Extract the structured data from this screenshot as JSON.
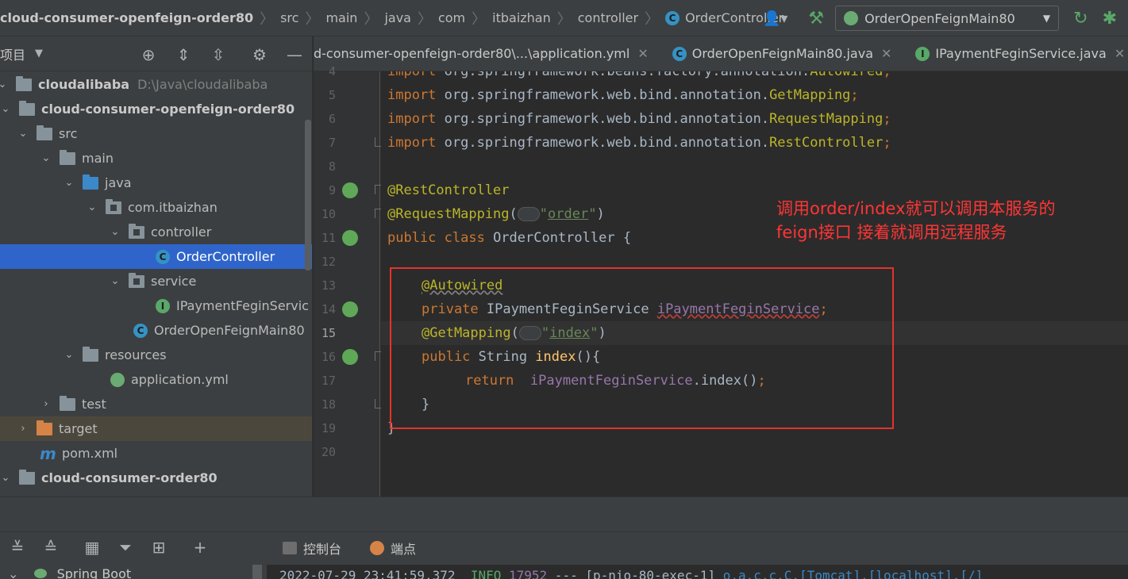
{
  "breadcrumbs": [
    "cloud-consumer-openfeign-order80",
    "src",
    "main",
    "java",
    "com",
    "itbaizhan",
    "controller",
    "OrderController"
  ],
  "run_config": "OrderOpenFeignMain80",
  "project": {
    "title": "项目",
    "tree": [
      {
        "label": "cloudalibaba",
        "path": "D:\\Java\\cloudalibaba"
      },
      {
        "label": "cloud-consumer-openfeign-order80"
      },
      {
        "label": "src"
      },
      {
        "label": "main"
      },
      {
        "label": "java"
      },
      {
        "label": "com.itbaizhan"
      },
      {
        "label": "controller"
      },
      {
        "label": "OrderController"
      },
      {
        "label": "service"
      },
      {
        "label": "IPaymentFeginServic"
      },
      {
        "label": "OrderOpenFeignMain80"
      },
      {
        "label": "resources"
      },
      {
        "label": "application.yml"
      },
      {
        "label": "test"
      },
      {
        "label": "target"
      },
      {
        "label": "pom.xml"
      },
      {
        "label": "cloud-consumer-order80"
      }
    ]
  },
  "tabs": [
    {
      "label": "d-consumer-openfeign-order80\\...\\application.yml"
    },
    {
      "label": "OrderOpenFeignMain80.java"
    },
    {
      "label": "IPaymentFeginService.java"
    }
  ],
  "editor": {
    "line_numbers": [
      "4",
      "5",
      "6",
      "7",
      "8",
      "9",
      "10",
      "11",
      "12",
      "13",
      "14",
      "15",
      "16",
      "17",
      "18",
      "19",
      "20"
    ],
    "lines": {
      "l4": {
        "a": "import ",
        "b": "org.springframework.beans.factory.annotation.",
        "c": "Autowired",
        "d": ";"
      },
      "l5": {
        "a": "import ",
        "b": "org.springframework.web.bind.annotation.",
        "c": "GetMapping",
        "d": ";"
      },
      "l6": {
        "a": "import ",
        "b": "org.springframework.web.bind.annotation.",
        "c": "RequestMapping",
        "d": ";"
      },
      "l7": {
        "a": "import ",
        "b": "org.springframework.web.bind.annotation.",
        "c": "RestController",
        "d": ";"
      },
      "l9": {
        "a": "@RestController"
      },
      "l10": {
        "a": "@RequestMapping",
        "b": "(",
        "c": "\"",
        "d": "order",
        "e": "\"",
        "f": ")"
      },
      "l11": {
        "a": "public class ",
        "b": "OrderController {"
      },
      "l13": {
        "a": "@Autowired"
      },
      "l14": {
        "a": "private ",
        "b": "IPaymentFeginService ",
        "c": "iPaymentFeginService",
        "d": ";"
      },
      "l15": {
        "a": "@GetMapping",
        "b": "(",
        "c": "\"",
        "d": "index",
        "e": "\"",
        "f": ")"
      },
      "l16": {
        "a": "public ",
        "b": "String ",
        "c": "index",
        "d": "(){"
      },
      "l17": {
        "a": "return  ",
        "b": "iPaymentFeginService",
        "c": ".index()",
        "d": ";"
      },
      "l18": {
        "a": "}"
      },
      "l19": {
        "a": "}"
      }
    }
  },
  "annotation": {
    "line1": "调用order/index就可以调用本服务的",
    "line2": "feign接口 接着就调用远程服务"
  },
  "bottom": {
    "tab_console": "控制台",
    "tab_endpoints": "端点",
    "spring_boot": "Spring Boot",
    "console": {
      "time": "2022-07-29 23:41:59.372  ",
      "level": "INFO ",
      "pid": "17952",
      "rest": " --- [p-nio-80-exec-1] ",
      "cls": "o.a.c.c.C.[Tomcat].[localhost].[/]"
    }
  },
  "colors": {
    "annotation_red": "#ff3535",
    "selection_blue": "#2f65ca"
  }
}
